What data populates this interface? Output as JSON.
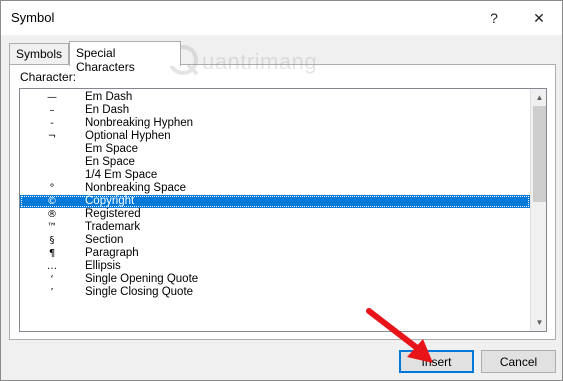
{
  "window": {
    "title": "Symbol",
    "help_label": "?",
    "close_label": "✕"
  },
  "tabs": [
    {
      "label": "Symbols",
      "active": false
    },
    {
      "label": "Special Characters",
      "active": true
    }
  ],
  "character_label": "Character:",
  "watermark_text": "uantrimang",
  "characters": [
    {
      "symbol": "—",
      "name": "Em Dash",
      "selected": false
    },
    {
      "symbol": "–",
      "name": "En Dash",
      "selected": false
    },
    {
      "symbol": "-",
      "name": "Nonbreaking Hyphen",
      "selected": false
    },
    {
      "symbol": "¬",
      "name": "Optional Hyphen",
      "selected": false
    },
    {
      "symbol": "",
      "name": "Em Space",
      "selected": false
    },
    {
      "symbol": "",
      "name": "En Space",
      "selected": false
    },
    {
      "symbol": "",
      "name": "1/4 Em Space",
      "selected": false
    },
    {
      "symbol": "°",
      "name": "Nonbreaking Space",
      "selected": false
    },
    {
      "symbol": "©",
      "name": "Copyright",
      "selected": true
    },
    {
      "symbol": "®",
      "name": "Registered",
      "selected": false
    },
    {
      "symbol": "™",
      "name": "Trademark",
      "selected": false
    },
    {
      "symbol": "§",
      "name": "Section",
      "selected": false
    },
    {
      "symbol": "¶",
      "name": "Paragraph",
      "selected": false
    },
    {
      "symbol": "…",
      "name": "Ellipsis",
      "selected": false
    },
    {
      "symbol": "‘",
      "name": "Single Opening Quote",
      "selected": false
    },
    {
      "symbol": "’",
      "name": "Single Closing Quote",
      "selected": false
    }
  ],
  "buttons": {
    "insert_label": "Insert",
    "cancel_label": "Cancel"
  },
  "colors": {
    "selection": "#0078d7",
    "arrow": "#e8141a"
  }
}
